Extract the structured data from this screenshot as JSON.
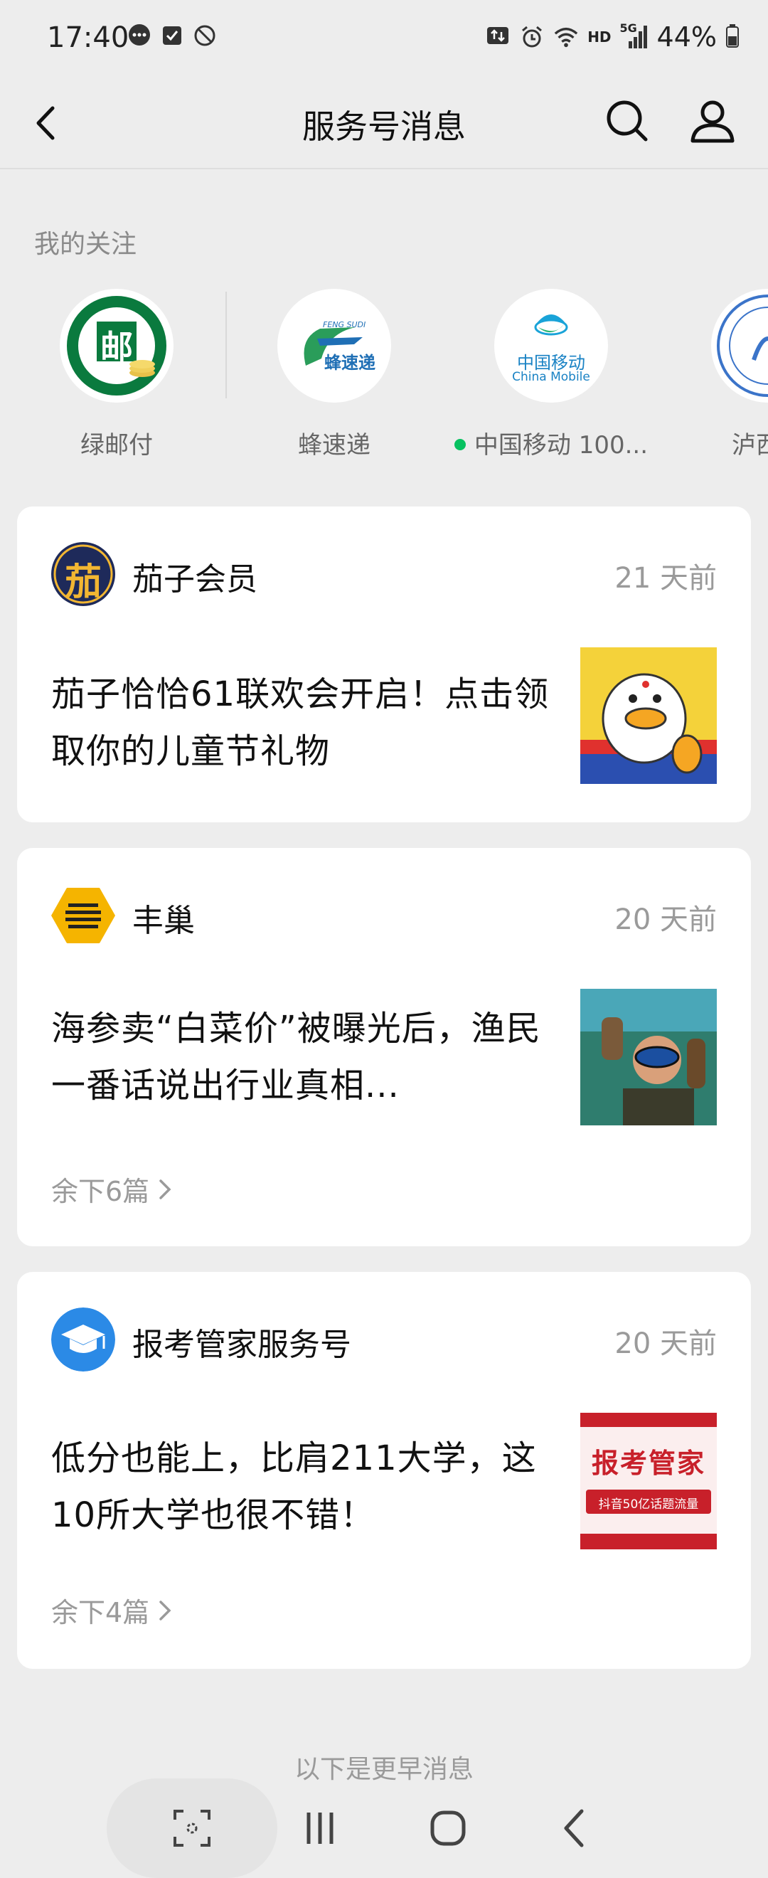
{
  "status_bar": {
    "time": "17:40",
    "battery_text": "44%",
    "hd_label": "HD",
    "network_label": "5G",
    "left_icons": [
      "message-bubble-icon",
      "checkbox-icon",
      "dnd-icon"
    ],
    "right_icons": [
      "data-transfer-icon",
      "alarm-icon",
      "wifi-icon",
      "signal-icon",
      "battery-icon"
    ]
  },
  "nav": {
    "title": "服务号消息",
    "back_icon": "back-chevron-icon",
    "search_icon": "search-icon",
    "profile_icon": "user-icon"
  },
  "follow": {
    "label": "我的关注",
    "items": [
      {
        "name": "绿邮付",
        "logo_text": "邮",
        "has_dot": false
      },
      {
        "name": "蜂速递",
        "logo_text": "蜂速递",
        "logo_subtext": "FENG SUDI",
        "has_dot": false
      },
      {
        "name": "中国移动 100...",
        "logo_text": "中国移动",
        "logo_subtext": "China Mobile",
        "has_dot": true
      },
      {
        "name": "泸西县",
        "has_dot": false
      }
    ]
  },
  "messages": [
    {
      "account": "茄子会员",
      "time": "21 天前",
      "avatar_text": "茄",
      "text": "茄子恰恰61联欢会开启！点击领取你的儿童节礼物",
      "more": ""
    },
    {
      "account": "丰巢",
      "time": "20 天前",
      "avatar_text": "",
      "text": "海参卖“白菜价”被曝光后，渔民一番话说出行业真相...",
      "more": "余下6篇"
    },
    {
      "account": "报考管家服务号",
      "time": "20 天前",
      "avatar_text": "",
      "text": "低分也能上，比肩211大学，这10所大学也很不错！",
      "more": "余下4篇",
      "thumb_title": "报考管家",
      "thumb_sub": "抖音50亿话题流量"
    }
  ],
  "earlier_label": "以下是更早消息",
  "system_nav": {
    "buttons": [
      "screenshot-scan-icon",
      "recents-icon",
      "home-icon",
      "back-icon"
    ]
  },
  "colors": {
    "background": "#ededed",
    "card": "#ffffff",
    "accent_green": "#07c160",
    "muted_text": "#9a9a9a"
  }
}
